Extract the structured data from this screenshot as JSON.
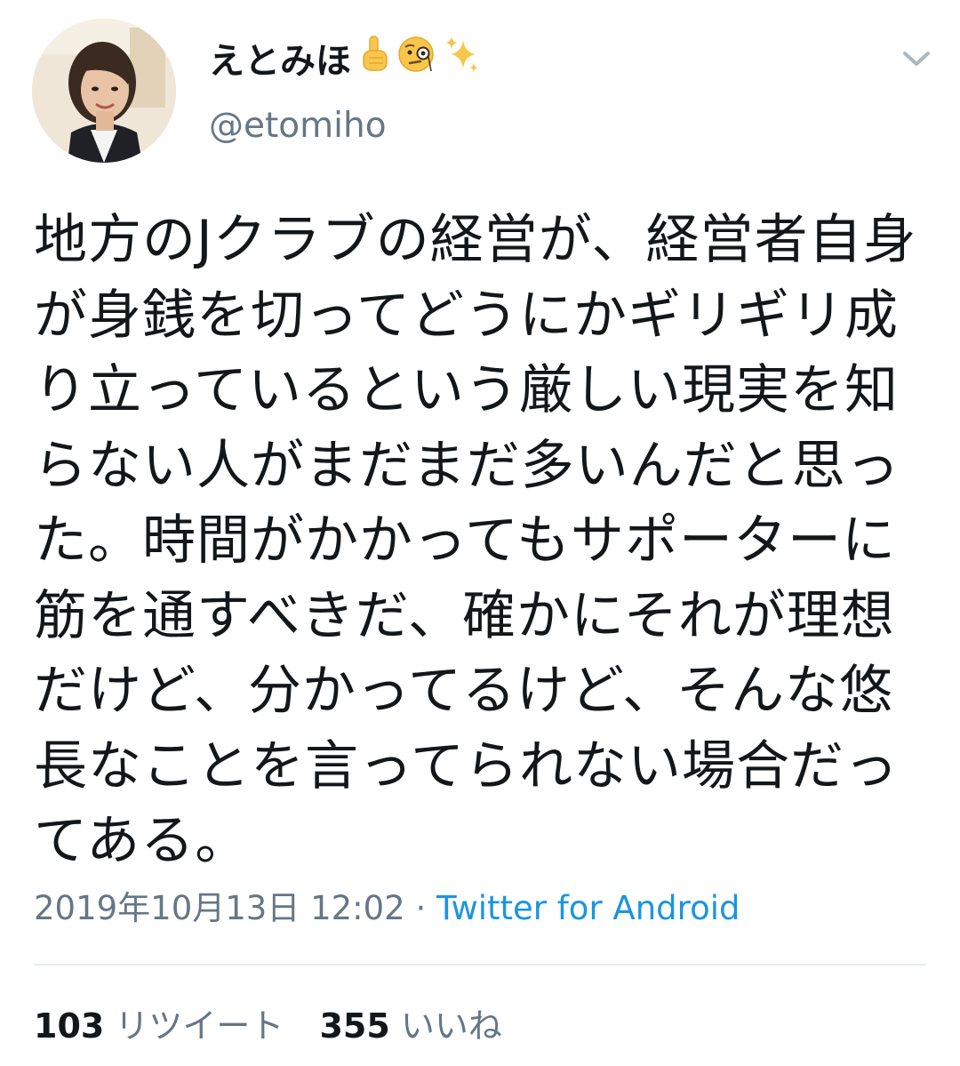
{
  "author": {
    "display_name": "えとみほ",
    "emojis": [
      "point-up-icon",
      "face-with-monocle-icon",
      "sparkles-icon"
    ],
    "handle": "@etomiho"
  },
  "tweet": {
    "text": "地方のJクラブの経営が、経営者自身が身銭を切ってどうにかギリギリ成り立っているという厳しい現実を知らない人がまだまだ多いんだと思った。時間がかかってもサポーターに筋を通すべきだ、確かにそれが理想だけど、分かってるけど、そんな悠長なことを言ってられない場合だってある。"
  },
  "meta": {
    "timestamp": "2019年10月13日 12:02",
    "separator": " · ",
    "source": "Twitter for Android"
  },
  "stats": {
    "retweets_count": "103",
    "retweets_label": "リツイート",
    "likes_count": "355",
    "likes_label": "いいね"
  },
  "colors": {
    "text": "#14171a",
    "secondary": "#657786",
    "link": "#1b95e0",
    "divider": "#e6ecf0"
  }
}
